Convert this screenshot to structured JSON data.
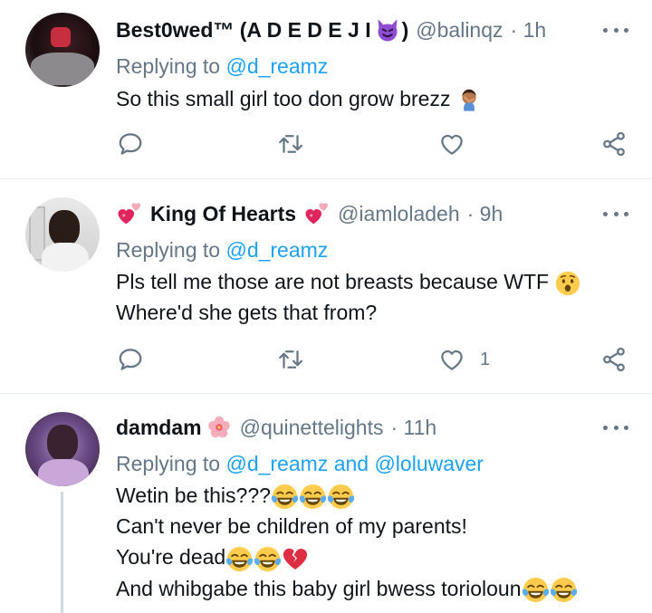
{
  "tweets": [
    {
      "display_name": "Best0wed™ (A D E D E J I",
      "display_name_suffix": ")",
      "handle": "@balinqz",
      "time": "· 1h",
      "reply_prefix": "Replying to",
      "reply_mention": "@d_reamz",
      "lines": [
        "So this small girl too don grow brezz"
      ],
      "like_count": "",
      "name_emoji_icon": "smiling-imp-icon",
      "text_emoji_icon": "facepalm-icon"
    },
    {
      "display_name": "King Of Hearts",
      "handle": "@iamloladeh",
      "time": "· 9h",
      "reply_prefix": "Replying to",
      "reply_mention": "@d_reamz",
      "lines": [
        "Pls tell me those are not breasts because WTF",
        "Where'd she gets that from?"
      ],
      "like_count": "1",
      "name_emoji_icon": "revolving-hearts-icon",
      "text_emoji_icon": "hushed-face-icon"
    },
    {
      "display_name": "damdam",
      "handle": "@quinettelights",
      "time": "· 11h",
      "reply_prefix": "Replying to",
      "reply_mention": "@d_reamz and @loluwaver",
      "lines": [
        "Wetin be this???",
        "Can't never be children of my parents!",
        "You're dead",
        "And whibgabe this baby girl bwess torioloun"
      ],
      "like_count": "",
      "name_emoji_icon": "hibiscus-icon",
      "text_emoji_icon": "tears-of-joy-icon"
    }
  ],
  "colors": {
    "secondary_text": "#657786",
    "link": "#1da1f2",
    "divider": "#e6ecf0",
    "icon": "#657786"
  }
}
